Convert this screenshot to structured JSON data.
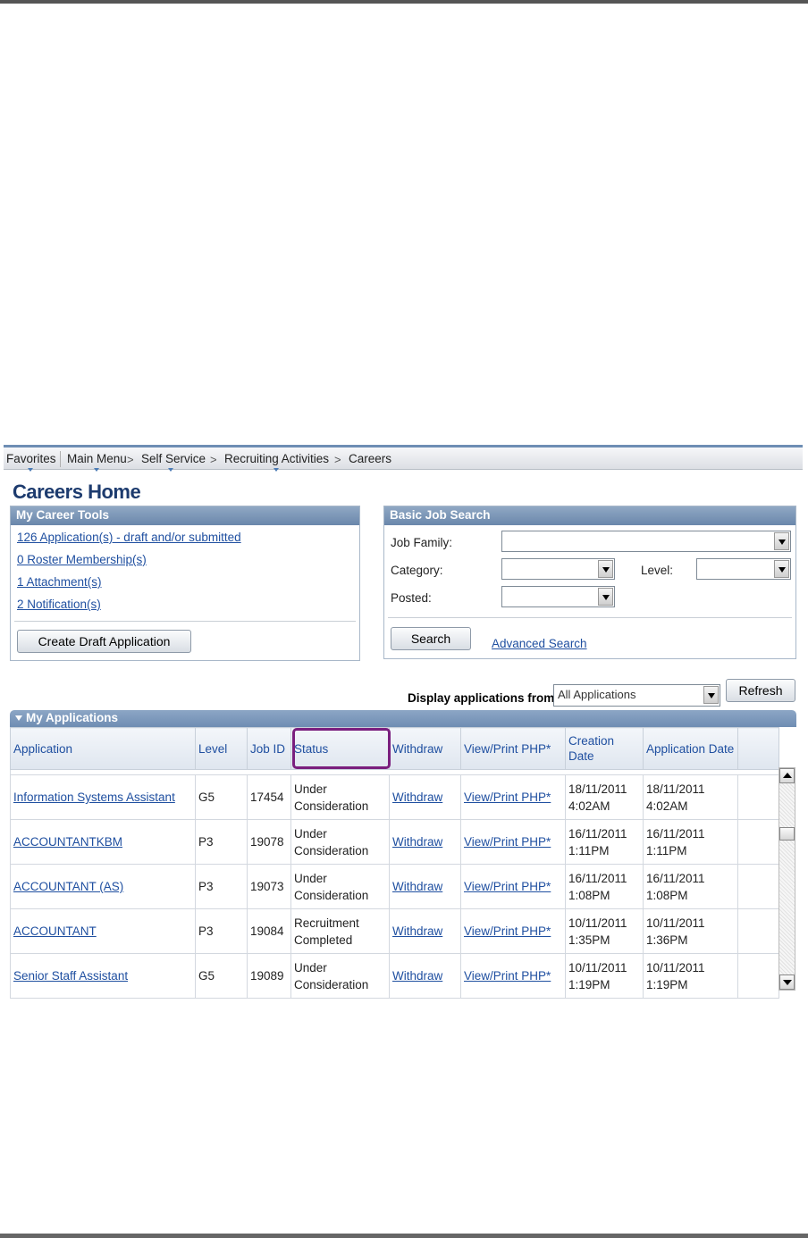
{
  "nav": {
    "favorites": "Favorites",
    "main_menu": "Main Menu",
    "self_service": "Self Service",
    "recruiting_activities": "Recruiting Activities",
    "careers": "Careers",
    "separator": ">"
  },
  "page_title": "Careers Home",
  "career_tools": {
    "title": "My Career Tools",
    "links": [
      "126 Application(s) - draft and/or submitted",
      "0 Roster Membership(s)",
      "1 Attachment(s)",
      "2 Notification(s)"
    ],
    "create_button": "Create Draft Application"
  },
  "job_search": {
    "title": "Basic Job Search",
    "job_family_label": "Job Family:",
    "job_family_value": "",
    "category_label": "Category:",
    "category_value": "",
    "level_label": "Level:",
    "level_value": "",
    "posted_label": "Posted:",
    "posted_value": "",
    "search_button": "Search",
    "advanced_search": "Advanced Search"
  },
  "display_filter": {
    "label": "Display applications from:",
    "value": "All Applications",
    "refresh_button": "Refresh"
  },
  "applications": {
    "title": "My Applications",
    "columns": [
      "Application",
      "Level",
      "Job ID",
      "Status",
      "Withdraw",
      "View/Print PHP*",
      "Creation Date",
      "Application Date"
    ],
    "rows": [
      {
        "application": "Information Systems Assistant",
        "level": "G5",
        "job_id": "17454",
        "status": "Under Consideration",
        "withdraw": "Withdraw",
        "view": "View/Print PHP*",
        "creation": "18/11/2011 4:02AM",
        "applied": "18/11/2011 4:02AM"
      },
      {
        "application": "ACCOUNTANTKBM",
        "level": "P3",
        "job_id": "19078",
        "status": "Under Consideration",
        "withdraw": "Withdraw",
        "view": "View/Print PHP*",
        "creation": "16/11/2011 1:11PM",
        "applied": "16/11/2011 1:11PM"
      },
      {
        "application": "ACCOUNTANT (AS)",
        "level": "P3",
        "job_id": "19073",
        "status": "Under Consideration",
        "withdraw": "Withdraw",
        "view": "View/Print PHP*",
        "creation": "16/11/2011 1:08PM",
        "applied": "16/11/2011 1:08PM"
      },
      {
        "application": "ACCOUNTANT",
        "level": "P3",
        "job_id": "19084",
        "status": "Recruitment Completed",
        "withdraw": "Withdraw",
        "view": "View/Print PHP*",
        "creation": "10/11/2011 1:35PM",
        "applied": "10/11/2011 1:36PM"
      },
      {
        "application": "Senior Staff Assistant",
        "level": "G5",
        "job_id": "19089",
        "status": "Under Consideration",
        "withdraw": "Withdraw",
        "view": "View/Print PHP*",
        "creation": "10/11/2011 1:19PM",
        "applied": "10/11/2011 1:19PM"
      }
    ]
  },
  "colors": {
    "link": "#1f4fa0",
    "header_bar": "#6f8db3",
    "highlight": "#7a1f7e",
    "title": "#1d3b6e"
  }
}
